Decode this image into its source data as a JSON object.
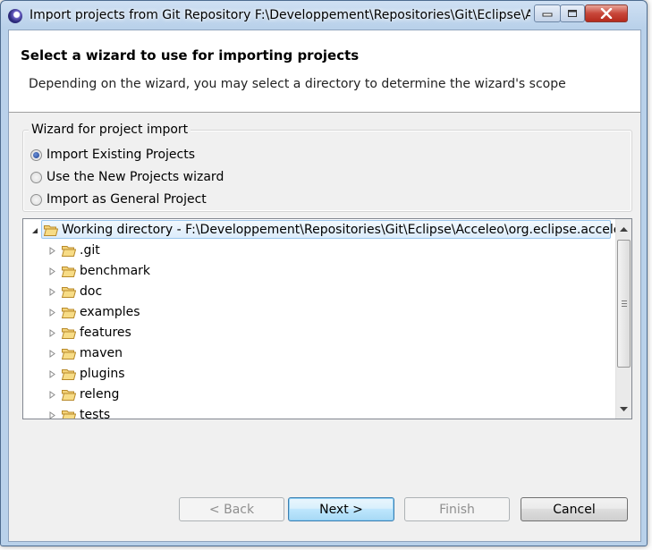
{
  "window": {
    "title": "Import projects from Git Repository F:\\Developpement\\Repositories\\Git\\Eclipse\\A..."
  },
  "banner": {
    "title": "Select a wizard to use for importing projects",
    "description": "Depending on the wizard, you may select a directory to determine the wizard's scope"
  },
  "wizard_group": {
    "label": "Wizard for project import",
    "options": [
      {
        "label": "Import Existing Projects",
        "selected": true
      },
      {
        "label": "Use the New Projects wizard",
        "selected": false
      },
      {
        "label": "Import as General Project",
        "selected": false
      }
    ]
  },
  "tree": {
    "root": {
      "label": "Working directory - F:\\Developpement\\Repositories\\Git\\Eclipse\\Acceleo\\org.eclipse.acceleo",
      "expanded": true
    },
    "children": [
      {
        "label": ".git"
      },
      {
        "label": "benchmark"
      },
      {
        "label": "doc"
      },
      {
        "label": "examples"
      },
      {
        "label": "features"
      },
      {
        "label": "maven"
      },
      {
        "label": "plugins"
      },
      {
        "label": "releng"
      },
      {
        "label": "tests"
      }
    ]
  },
  "buttons": {
    "back": "< Back",
    "next": "Next >",
    "finish": "Finish",
    "cancel": "Cancel"
  },
  "colors": {
    "folder": "#e8b949",
    "selection_border": "#99c6ee",
    "frame": "#b9d1ea"
  }
}
